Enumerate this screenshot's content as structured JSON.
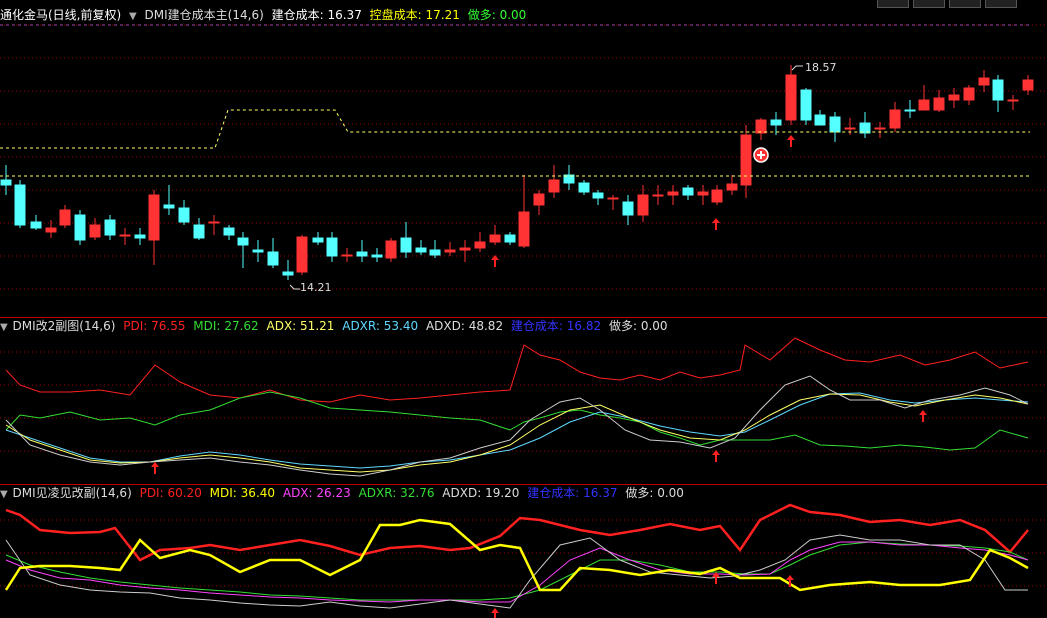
{
  "main_panel": {
    "stock_name": "通化金马(日线,前复权)",
    "indicator_name": "DMI建仓成本主(14,6)",
    "cost_label": "建仓成本:",
    "cost_value": "16.37",
    "control_label": "控盘成本:",
    "control_value": "17.21",
    "long_label": "做多:",
    "long_value": "0.00",
    "high_label": "18.57",
    "low_label": "14.21"
  },
  "panel2": {
    "title": "DMI改2副图(14,6)",
    "pdi_label": "PDI:",
    "pdi_value": "76.55",
    "mdi_label": "MDI:",
    "mdi_value": "27.62",
    "adx_label": "ADX:",
    "adx_value": "51.21",
    "adxr_label": "ADXR:",
    "adxr_value": "53.40",
    "adxd_label": "ADXD:",
    "adxd_value": "48.82",
    "cost_label": "建仓成本:",
    "cost_value": "16.82",
    "long_label": "做多:",
    "long_value": "0.00"
  },
  "panel3": {
    "title": "DMI见凌见改副(14,6)",
    "pdi_label": "PDI:",
    "pdi_value": "60.20",
    "mdi_label": "MDI:",
    "mdi_value": "36.40",
    "adx_label": "ADX:",
    "adx_value": "26.23",
    "adxr_label": "ADXR:",
    "adxr_value": "32.76",
    "adxd_label": "ADXD:",
    "adxd_value": "19.20",
    "cost_label": "建仓成本:",
    "cost_value": "16.37",
    "long_label": "做多:",
    "long_value": "0.00"
  },
  "colors": {
    "up": "#ff3333",
    "down": "#54ffff",
    "pdi": "#ff2020",
    "mdi_green": "#33dd33",
    "mdi_yellow": "#ffff00",
    "adx_white": "#ffffff",
    "adxr_cyan": "#5fd7ff",
    "adx_magenta": "#ff44ff",
    "cost_blue": "#3333ff",
    "grid": "#a00000",
    "dashed_yellow": "#ffff66"
  },
  "icons": {
    "arrow": "up-arrow-icon",
    "mark": "plus-circle-icon",
    "collapse": "chevron-down-icon"
  }
}
